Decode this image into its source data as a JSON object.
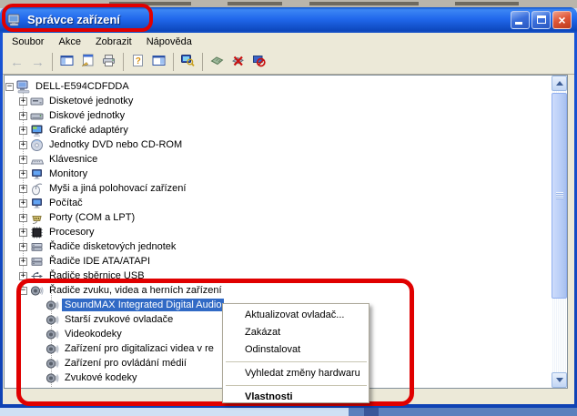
{
  "colors": {
    "annotation_red": "#e00000",
    "selection_blue": "#316ac5",
    "titlebar_blue": "#2168ec",
    "chrome_beige": "#ece9d8"
  },
  "window": {
    "title": "Správce zařízení",
    "title_icon": "device-manager-icon",
    "controls": [
      {
        "name": "minimize-button",
        "glyph": "minimize"
      },
      {
        "name": "maximize-button",
        "glyph": "maximize"
      },
      {
        "name": "close-button",
        "glyph": "close",
        "label": "×"
      }
    ],
    "menu": [
      {
        "label": "Soubor"
      },
      {
        "label": "Akce"
      },
      {
        "label": "Zobrazit"
      },
      {
        "label": "Nápověda"
      }
    ],
    "toolbar": [
      {
        "name": "back-button",
        "icon": "back-arrow-icon",
        "enabled": false
      },
      {
        "name": "forward-button",
        "icon": "forward-arrow-icon",
        "enabled": false,
        "sep_after": true
      },
      {
        "name": "show-console-tree-button",
        "icon": "console-tree-icon",
        "enabled": true
      },
      {
        "name": "properties-button",
        "icon": "properties-icon",
        "enabled": true
      },
      {
        "name": "print-button",
        "icon": "print-icon",
        "enabled": true,
        "sep_after": true
      },
      {
        "name": "help-button",
        "icon": "help-icon",
        "enabled": true
      },
      {
        "name": "show-action-pane-button",
        "icon": "action-pane-icon",
        "enabled": true,
        "sep_after": true
      },
      {
        "name": "scan-hardware-changes-button",
        "icon": "scan-hardware-icon",
        "enabled": true,
        "sep_after": true
      },
      {
        "name": "update-driver-button",
        "icon": "update-driver-icon",
        "enabled": true
      },
      {
        "name": "disable-device-button",
        "icon": "disable-device-icon",
        "enabled": true
      },
      {
        "name": "uninstall-device-button",
        "icon": "uninstall-device-icon",
        "enabled": true
      }
    ]
  },
  "tree": {
    "rows": [
      {
        "label": "DELL-E594CDFDDA",
        "icon": "computer-icon",
        "level": 0,
        "expand": "-"
      },
      {
        "label": "Disketové jednotky",
        "icon": "floppy-drive-icon",
        "level": 1,
        "expand": "+"
      },
      {
        "label": "Diskové jednotky",
        "icon": "disk-drive-icon",
        "level": 1,
        "expand": "+"
      },
      {
        "label": "Grafické adaptéry",
        "icon": "display-adapter-icon",
        "level": 1,
        "expand": "+"
      },
      {
        "label": "Jednotky DVD nebo CD-ROM",
        "icon": "cdrom-icon",
        "level": 1,
        "expand": "+"
      },
      {
        "label": "Klávesnice",
        "icon": "keyboard-icon",
        "level": 1,
        "expand": "+"
      },
      {
        "label": "Monitory",
        "icon": "monitor-icon",
        "level": 1,
        "expand": "+"
      },
      {
        "label": "Myši a jiná polohovací zařízení",
        "icon": "mouse-icon",
        "level": 1,
        "expand": "+"
      },
      {
        "label": "Počítač",
        "icon": "monitor-icon",
        "level": 1,
        "expand": "+"
      },
      {
        "label": "Porty (COM a LPT)",
        "icon": "port-icon",
        "level": 1,
        "expand": "+"
      },
      {
        "label": "Procesory",
        "icon": "processor-icon",
        "level": 1,
        "expand": "+"
      },
      {
        "label": "Řadiče disketových jednotek",
        "icon": "controller-icon",
        "level": 1,
        "expand": "+"
      },
      {
        "label": "Řadiče IDE ATA/ATAPI",
        "icon": "controller-icon",
        "level": 1,
        "expand": "+"
      },
      {
        "label": "Řadiče sběrnice USB",
        "icon": "usb-icon",
        "level": 1,
        "expand": "+"
      },
      {
        "label": "Řadiče zvuku, videa a herních zařízení",
        "icon": "speaker-icon",
        "level": 1,
        "expand": "-"
      },
      {
        "label": "SoundMAX Integrated Digital Audio",
        "icon": "speaker-icon",
        "level": 2,
        "selected": true
      },
      {
        "label": "Starší zvukové ovladače",
        "icon": "speaker-icon",
        "level": 2
      },
      {
        "label": "Videokodeky",
        "icon": "speaker-icon",
        "level": 2
      },
      {
        "label": "Zařízení pro digitalizaci videa v re",
        "icon": "speaker-icon",
        "level": 2
      },
      {
        "label": "Zařízení pro ovládání médií",
        "icon": "speaker-icon",
        "level": 2
      },
      {
        "label": "Zvukové kodeky",
        "icon": "speaker-icon",
        "level": 2
      },
      {
        "label": "",
        "icon": "speaker-icon",
        "level": 2,
        "partial": true
      }
    ]
  },
  "context_menu": {
    "items": [
      {
        "label": "Aktualizovat ovladač...",
        "bold": false
      },
      {
        "label": "Zakázat",
        "bold": false
      },
      {
        "label": "Odinstalovat",
        "bold": false,
        "sep_after": true
      },
      {
        "label": "Vyhledat změny hardwaru",
        "bold": false,
        "sep_after": true
      },
      {
        "label": "Vlastnosti",
        "bold": true
      }
    ]
  },
  "annotations": [
    {
      "name": "title-highlight",
      "target": "window-title"
    },
    {
      "name": "sound-section-highlight",
      "target": "sound-video-game-controllers-subtree"
    }
  ]
}
